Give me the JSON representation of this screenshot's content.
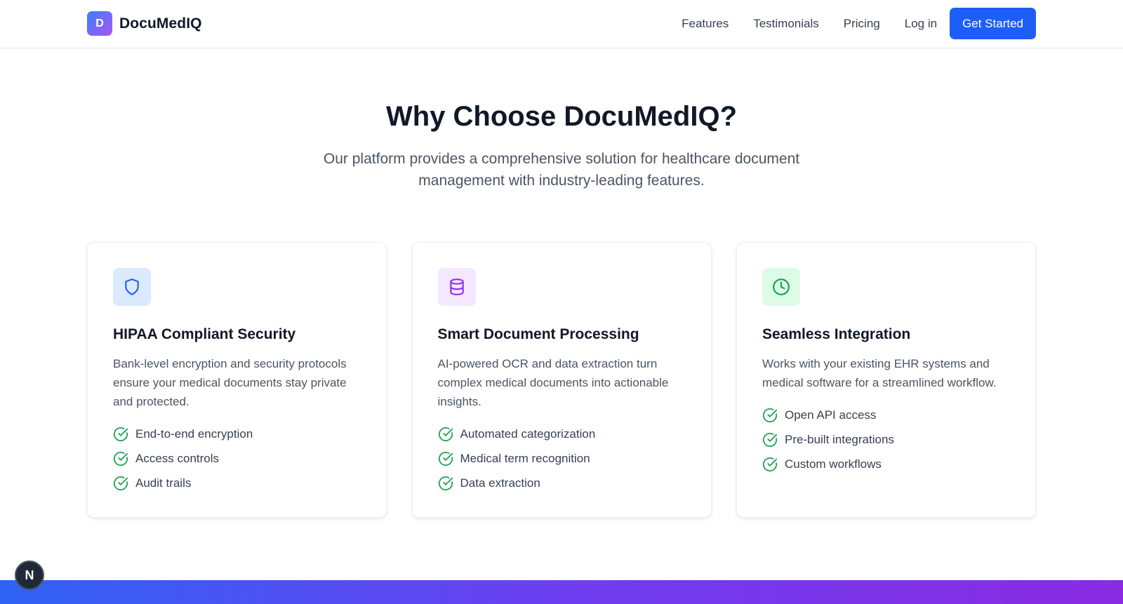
{
  "nav": {
    "brand_initial": "D",
    "brand_name": "DocuMedIQ",
    "links": [
      "Features",
      "Testimonials",
      "Pricing"
    ],
    "login_label": "Log in",
    "cta_label": "Get Started"
  },
  "section": {
    "title": "Why Choose DocuMedIQ?",
    "subtitle": "Our platform provides a comprehensive solution for healthcare document management with industry-leading features."
  },
  "cards": [
    {
      "icon": "shield-icon",
      "icon_bg": "#dbeafe",
      "icon_color": "#2563eb",
      "title": "HIPAA Compliant Security",
      "description": "Bank-level encryption and security protocols ensure your medical documents stay private and protected.",
      "features": [
        "End-to-end encryption",
        "Access controls",
        "Audit trails"
      ]
    },
    {
      "icon": "database-icon",
      "icon_bg": "#f3e8ff",
      "icon_color": "#9333ea",
      "title": "Smart Document Processing",
      "description": "AI-powered OCR and data extraction turn complex medical documents into actionable insights.",
      "features": [
        "Automated categorization",
        "Medical term recognition",
        "Data extraction"
      ]
    },
    {
      "icon": "clock-icon",
      "icon_bg": "#dcfce7",
      "icon_color": "#16a34a",
      "title": "Seamless Integration",
      "description": "Works with your existing EHR systems and medical software for a streamlined workflow.",
      "features": [
        "Open API access",
        "Pre-built integrations",
        "Custom workflows"
      ]
    }
  ],
  "colors": {
    "accent": "#1d5ff6",
    "check": "#22a55a",
    "gradient_start": "#2f62f5",
    "gradient_end": "#8a2be2"
  },
  "next_badge_letter": "N"
}
